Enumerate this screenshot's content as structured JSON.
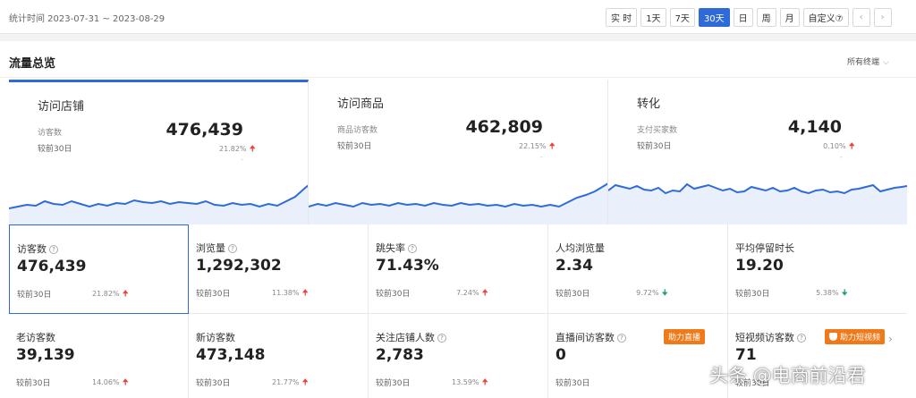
{
  "period": "统计时间 2023-07-31 ~ 2023-08-29",
  "time_buttons": [
    "实 时",
    "1天",
    "7天",
    "30天",
    "日",
    "周",
    "月",
    "自定义⑦"
  ],
  "active_time": "30天",
  "nav_prev": "‹",
  "nav_next": "›",
  "section_title": "流量总览",
  "terminal_select": "所有终端",
  "overview": [
    {
      "title": "访问店铺",
      "sub": "访客数",
      "value": "476,439",
      "compare": "较前30日",
      "pct": "21.82%",
      "trend": "up",
      "dash": "-"
    },
    {
      "title": "访问商品",
      "sub": "商品访客数",
      "value": "462,809",
      "compare": "较前30日",
      "pct": "22.15%",
      "trend": "up",
      "dash": "-"
    },
    {
      "title": "转化",
      "sub": "支付买家数",
      "value": "4,140",
      "compare": "较前30日",
      "pct": "0.10%",
      "trend": "up",
      "dash": "-"
    }
  ],
  "metrics_row1": [
    {
      "label": "访客数",
      "help": true,
      "value": "476,439",
      "compare": "较前30日",
      "pct": "21.82%",
      "trend": "up",
      "selected": true
    },
    {
      "label": "浏览量",
      "help": true,
      "value": "1,292,302",
      "compare": "较前30日",
      "pct": "11.38%",
      "trend": "up"
    },
    {
      "label": "跳失率",
      "help": true,
      "value": "71.43%",
      "compare": "较前30日",
      "pct": "7.24%",
      "trend": "up"
    },
    {
      "label": "人均浏览量",
      "help": false,
      "value": "2.34",
      "compare": "较前30日",
      "pct": "9.72%",
      "trend": "down"
    },
    {
      "label": "平均停留时长",
      "help": false,
      "value": "19.20",
      "compare": "较前30日",
      "pct": "5.38%",
      "trend": "down"
    }
  ],
  "metrics_row2": [
    {
      "label": "老访客数",
      "help": false,
      "value": "39,139",
      "compare": "较前30日",
      "pct": "14.06%",
      "trend": "up"
    },
    {
      "label": "新访客数",
      "help": false,
      "value": "473,148",
      "compare": "较前30日",
      "pct": "21.77%",
      "trend": "up"
    },
    {
      "label": "关注店铺人数",
      "help": true,
      "value": "2,783",
      "compare": "较前30日",
      "pct": "13.59%",
      "trend": "up"
    },
    {
      "label": "直播间访客数",
      "help": true,
      "value": "0",
      "compare": "较前30日",
      "pct": "",
      "trend": "",
      "tag": "助力直播"
    },
    {
      "label": "短视频访客数",
      "help": true,
      "value": "71",
      "compare": "较前30日",
      "pct": "",
      "trend": "",
      "tag": "助力短视频"
    }
  ],
  "icons": {
    "help": "question-circle-icon",
    "up": "arrow-up-icon",
    "down": "arrow-down-icon",
    "chevron": "chevron-down-icon"
  },
  "colors": {
    "accent": "#2f6bd8",
    "up": "#e8453c",
    "down": "#22a36b",
    "tag": "#f07a19"
  },
  "watermark": "头条 @电商前沿君"
}
